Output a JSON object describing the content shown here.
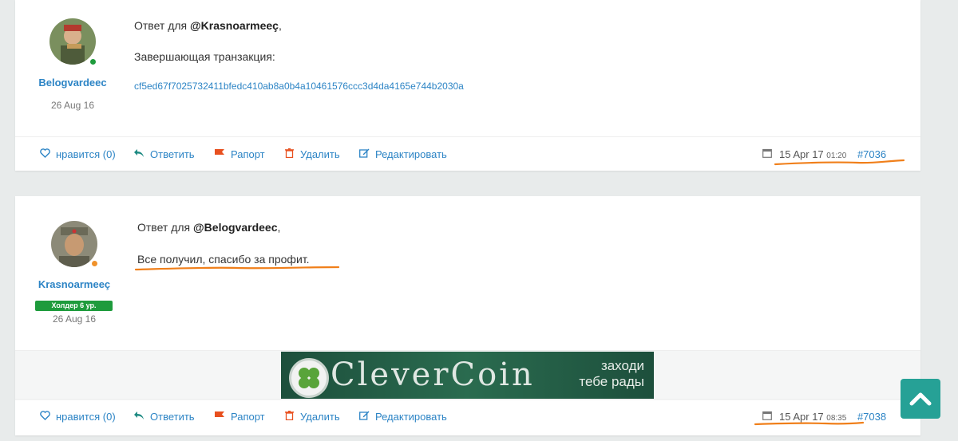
{
  "posts": [
    {
      "author": "Belogvardeec",
      "join_date": "26 Aug 16",
      "reply_prefix": "Ответ для",
      "reply_to": "@Krasnoarmeeç",
      "reply_suffix": ",",
      "text": "Завершающая транзакция:",
      "tx_hash": "cf5ed67f7025732411bfedc410ab8a0b4a10461576ccc3d4da4165e744b2030a",
      "date": "15 Apr 17",
      "time": "01:20",
      "post_number": "#7036"
    },
    {
      "author": "Krasnoarmeeç",
      "rank": "Холдер 6 ур.",
      "join_date": "26 Aug 16",
      "reply_prefix": "Ответ для",
      "reply_to": "@Belogvardeec",
      "reply_suffix": ",",
      "text": "Все получил, спасибо за профит.",
      "date": "15 Apr 17",
      "time": "08:35",
      "post_number": "#7038"
    }
  ],
  "actions": {
    "like": "нравится (0)",
    "reply": "Ответить",
    "report": "Рапорт",
    "delete": "Удалить",
    "edit": "Редактировать"
  },
  "banner": {
    "brand": "CleverCoin",
    "tagline_line1": "заходи",
    "tagline_line2": "тебе рады"
  },
  "icons": {
    "like": "heart-icon",
    "reply": "reply-arrow-icon",
    "report": "flag-icon",
    "delete": "trash-icon",
    "edit": "edit-icon",
    "date": "calendar-icon",
    "scroll": "chevron-up-icon"
  },
  "colors": {
    "link": "#2c84c5",
    "online": "#1e9b3c",
    "away": "#f0922b",
    "rank_badge": "#1e9b3c",
    "annotation": "#f07f1a",
    "scroll_button": "#26a196"
  }
}
